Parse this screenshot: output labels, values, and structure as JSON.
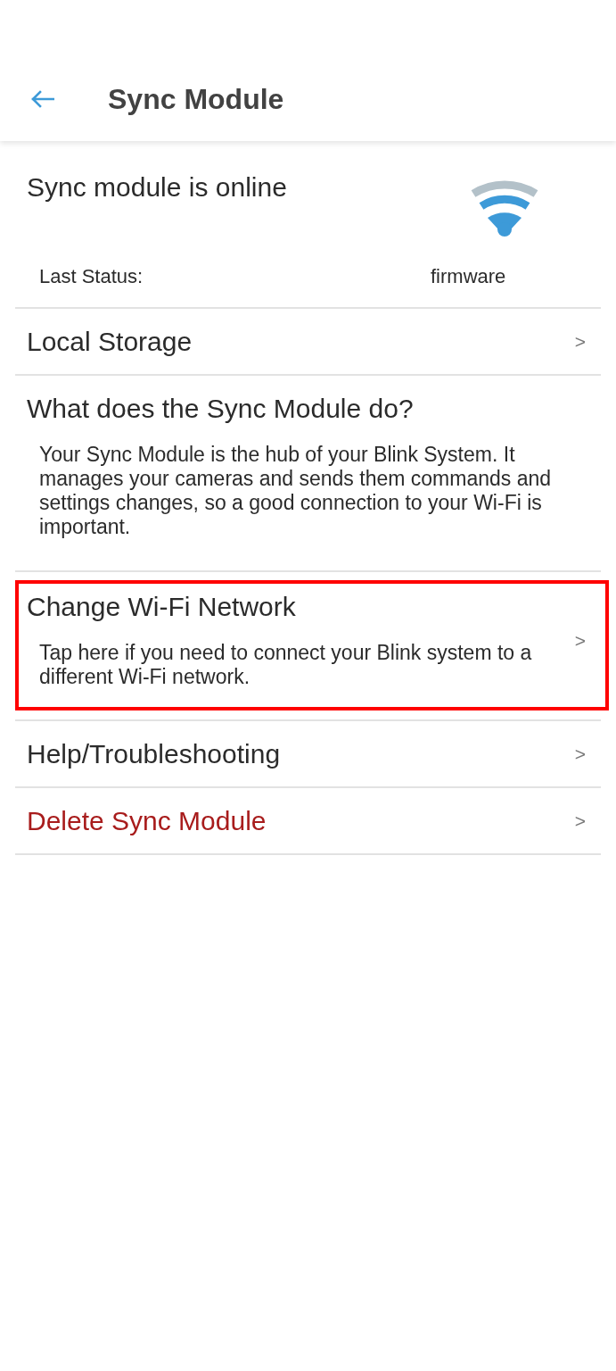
{
  "app_bar": {
    "title": "Sync Module"
  },
  "status": {
    "title": "Sync module is online",
    "online": true,
    "last_status_label": "Last Status:",
    "last_status_value": "firmware"
  },
  "items": [
    {
      "kind": "nav",
      "title": "Local Storage",
      "chevron": ">",
      "highlighted": false
    },
    {
      "kind": "info",
      "title": "What does the Sync Module do?",
      "description": "Your Sync Module is the hub of your Blink System. It manages your cameras and sends them commands and settings changes, so a good connection to your Wi-Fi is important.",
      "highlighted": false
    },
    {
      "kind": "nav",
      "title": "Change Wi-Fi Network",
      "description": "Tap here if you need to connect your Blink system to a different Wi-Fi network.",
      "chevron": ">",
      "highlighted": true
    },
    {
      "kind": "nav",
      "title": "Help/Troubleshooting",
      "chevron": ">",
      "highlighted": false
    },
    {
      "kind": "danger",
      "title": "Delete Sync Module",
      "chevron": ">",
      "highlighted": false
    }
  ]
}
